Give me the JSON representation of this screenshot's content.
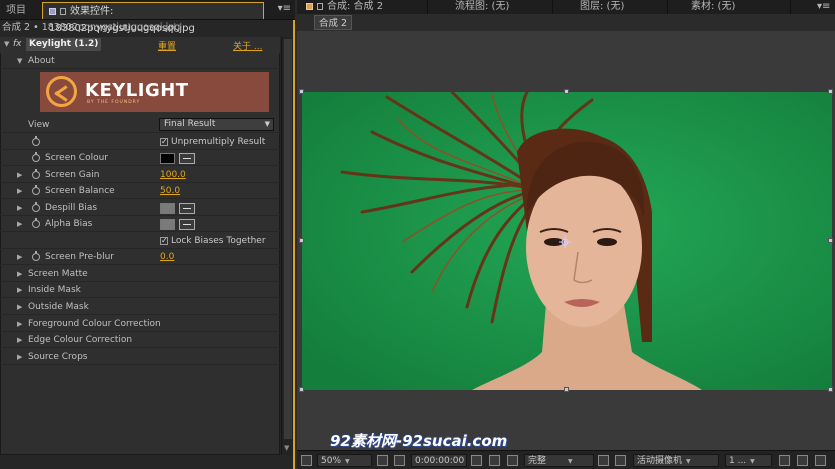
{
  "left_panel": {
    "tab_project": "项目",
    "tab_effect_controls": "效果控件: 183802pqnygstjuugqosqi.jpg",
    "menu_glyph": "▾≡",
    "subtitle": "合成 2 • 183802pqnygstjuugqosqi.jpg",
    "effect": {
      "fx_glyph": "fx",
      "name": "Keylight (1.2)",
      "reset": "重置",
      "about_link": "关于 ..."
    },
    "about_label": "About",
    "logo": {
      "word": "KEYLIGHT",
      "sub": "BY THE FOUNDRY",
      "bg": "#884a3c",
      "accent": "#f2a541"
    },
    "view_label": "View",
    "view_value": "Final Result",
    "unpremultiply_label": "Unpremultiply Result",
    "params": [
      {
        "label": "Screen Colour"
      },
      {
        "label": "Screen Gain",
        "value": "100.0"
      },
      {
        "label": "Screen Balance",
        "value": "50.0"
      },
      {
        "label": "Despill Bias"
      },
      {
        "label": "Alpha Bias"
      }
    ],
    "lock_biases_label": "Lock Biases Together",
    "screen_preblur": {
      "label": "Screen Pre-blur",
      "value": "0.0"
    },
    "groups": [
      "Screen Matte",
      "Inside Mask",
      "Outside Mask",
      "Foreground Colour Correction",
      "Edge Colour Correction",
      "Source Crops"
    ],
    "check_glyph": "✓",
    "screen_colour_swatch": "#000000",
    "bias_swatch": "#7a7a7a"
  },
  "right_panel": {
    "tab_comp": "合成: 合成 2",
    "tab_flowchart": "流程图: (无)",
    "tab_layer": "图层: (无)",
    "tab_footage": "素材: (无)",
    "comp_chip": "合成 2",
    "zoom": "50%",
    "timecode": "0:00:00:00",
    "resolution": "完整",
    "camera": "活动摄像机",
    "views": "1 ...",
    "green": "#1a9a4e"
  },
  "watermark": "92素材网-92sucai.com"
}
